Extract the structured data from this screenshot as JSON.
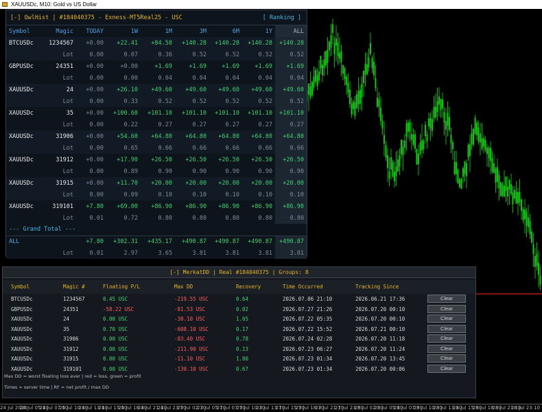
{
  "window": {
    "title": "XAUUSDc, M10:  Gold vs US Dollar",
    "icon": "chart-window-icon"
  },
  "chart_data": {
    "type": "candlestick",
    "symbol": "XAUUSDc",
    "timeframe": "M10",
    "bull_color": "#00e600",
    "bear_color": "#00e600",
    "price_line_color": "#ff2d2d",
    "price_line_level": 0.28,
    "x_tick_labels": [
      "24 Jul 2026",
      "24 Jul 05:10",
      "24 Jul 07:50",
      "24 Jul 10:30",
      "24 Jul 13:10",
      "24 Jul 15:50",
      "24 Jul 18:30",
      "24 Jul 21:10",
      "24 Jul 23:50",
      "27 Jul 02:30",
      "27 Jul 05:10",
      "27 Jul 07:50",
      "27 Jul 10:30",
      "27 Jul 13:10",
      "27 Jul 15:50",
      "27 Jul 18:30",
      "27 Jul 21:10",
      "27 Jul 23:50",
      "28 Jul 02:30",
      "28 Jul 05:10",
      "28 Jul 07:50",
      "28 Jul 10:30",
      "28 Jul 13:10",
      "28 Jul 15:50",
      "28 Jul 18:30",
      "28 Jul 21:10",
      "28 Jul 23:10"
    ]
  },
  "owlhist": {
    "title": "[-] OwlHist | #184040375 - Exness-MT5Real25 - USC",
    "ranking_label": "[ Ranking ]",
    "columns": [
      "Symbol",
      "Magic",
      "TODAY",
      "1W",
      "1M",
      "3M",
      "6M",
      "1Y",
      "ALL"
    ],
    "lot_label": "Lot",
    "rows": [
      {
        "symbol": "BTCUSDc",
        "magic": "1234567",
        "pnl": [
          "+0.00",
          "+22.41",
          "+84.58",
          "+140.28",
          "+140.28",
          "+140.28",
          "+140.28"
        ],
        "lot": [
          "0.00",
          "0.07",
          "0.36",
          "0.52",
          "0.52",
          "0.52",
          "0.52"
        ]
      },
      {
        "symbol": "GBPUSDc",
        "magic": "24351",
        "pnl": [
          "+0.00",
          "+0.00",
          "+1.69",
          "+1.69",
          "+1.69",
          "+1.69",
          "+1.69"
        ],
        "lot": [
          "0.00",
          "0.00",
          "0.04",
          "0.04",
          "0.04",
          "0.04",
          "0.04"
        ]
      },
      {
        "symbol": "XAUUSDc",
        "magic": "24",
        "pnl": [
          "+0.00",
          "+26.10",
          "+49.60",
          "+49.60",
          "+49.60",
          "+49.60",
          "+49.60"
        ],
        "lot": [
          "0.00",
          "0.33",
          "0.52",
          "0.52",
          "0.52",
          "0.52",
          "0.52"
        ]
      },
      {
        "symbol": "XAUUSDc",
        "magic": "35",
        "pnl": [
          "+0.00",
          "+100.60",
          "+101.10",
          "+101.10",
          "+101.10",
          "+101.10",
          "+101.10"
        ],
        "lot": [
          "0.00",
          "0.22",
          "0.27",
          "0.27",
          "0.27",
          "0.27",
          "0.27"
        ]
      },
      {
        "symbol": "XAUUSDc",
        "magic": "31906",
        "pnl": [
          "+0.00",
          "+54.60",
          "+64.80",
          "+64.80",
          "+64.80",
          "+64.80",
          "+64.80"
        ],
        "lot": [
          "0.00",
          "0.65",
          "0.66",
          "0.66",
          "0.66",
          "0.66",
          "0.66"
        ]
      },
      {
        "symbol": "XAUUSDc",
        "magic": "31912",
        "pnl": [
          "+0.00",
          "+17.90",
          "+26.50",
          "+26.50",
          "+26.50",
          "+26.50",
          "+26.50"
        ],
        "lot": [
          "0.00",
          "0.89",
          "0.90",
          "0.90",
          "0.90",
          "0.90",
          "0.90"
        ]
      },
      {
        "symbol": "XAUUSDc",
        "magic": "31915",
        "pnl": [
          "+0.00",
          "+11.70",
          "+20.00",
          "+20.00",
          "+20.00",
          "+20.00",
          "+20.00"
        ],
        "lot": [
          "0.00",
          "0.09",
          "0.10",
          "0.10",
          "0.10",
          "0.10",
          "0.10"
        ]
      },
      {
        "symbol": "XAUUSDc",
        "magic": "319101",
        "pnl": [
          "+7.80",
          "+69.00",
          "+86.90",
          "+86.90",
          "+86.90",
          "+86.90",
          "+86.90"
        ],
        "lot": [
          "0.01",
          "0.72",
          "0.80",
          "0.80",
          "0.80",
          "0.80",
          "0.80"
        ]
      }
    ],
    "grand_total_label": "--- Grand Total ---",
    "total": {
      "symbol": "ALL",
      "magic": "",
      "pnl": [
        "+7.80",
        "+302.31",
        "+435.17",
        "+490.87",
        "+490.87",
        "+490.87",
        "+490.87"
      ],
      "lot": [
        "0.01",
        "2.97",
        "3.65",
        "3.81",
        "3.81",
        "3.81",
        "3.81"
      ]
    },
    "colors": {
      "title": "#e6b422",
      "header": "#4ea0e0",
      "positive": "#3fd26e"
    }
  },
  "merkatdd": {
    "title": "[-] MerkatDD | Real #184040375 | Groups: 8",
    "columns": [
      "Symbol",
      "Magic #",
      "Floating P/L",
      "Max DD",
      "Recovery",
      "Time Occurred",
      "Tracking Since"
    ],
    "clear_label": "Clear",
    "rows": [
      {
        "symbol": "BTCUSDc",
        "magic": "1234567",
        "floating": "0.45 USC",
        "floating_sign": "pos",
        "maxdd": "-219.55 USC",
        "recovery": "0.64",
        "time": "2026.07.06 21:10",
        "since": "2026.06.21 17:36"
      },
      {
        "symbol": "GBPUSDc",
        "magic": "24351",
        "floating": "-58.22 USC",
        "floating_sign": "neg",
        "maxdd": "-81.53 USC",
        "recovery": "0.02",
        "time": "2026.07.27 21:26",
        "since": "2026.07.20 00:10"
      },
      {
        "symbol": "XAUUSDc",
        "magic": "24",
        "floating": "0.00 USC",
        "floating_sign": "pos",
        "maxdd": "-30.10 USC",
        "recovery": "1.65",
        "time": "2026.07.22 05:35",
        "since": "2026.07.20 00:10"
      },
      {
        "symbol": "XAUUSDc",
        "magic": "35",
        "floating": "0.70 USC",
        "floating_sign": "pos",
        "maxdd": "-608.10 USC",
        "recovery": "0.17",
        "time": "2026.07.22 15:52",
        "since": "2026.07.21 00:10"
      },
      {
        "symbol": "XAUUSDc",
        "magic": "31906",
        "floating": "0.00 USC",
        "floating_sign": "pos",
        "maxdd": "-83.40 USC",
        "recovery": "0.78",
        "time": "2026.07.24 02:28",
        "since": "2026.07.20 11:18"
      },
      {
        "symbol": "XAUUSDc",
        "magic": "31912",
        "floating": "0.00 USC",
        "floating_sign": "pos",
        "maxdd": "-211.90 USC",
        "recovery": "0.13",
        "time": "2026.07.23 06:27",
        "since": "2026.07.20 11:24"
      },
      {
        "symbol": "XAUUSDc",
        "magic": "31915",
        "floating": "0.00 USC",
        "floating_sign": "pos",
        "maxdd": "-11.10 USC",
        "recovery": "1.80",
        "time": "2026.07.23 01:34",
        "since": "2026.07.20 13:45"
      },
      {
        "symbol": "XAUUSDc",
        "magic": "319101",
        "floating": "0.00 USC",
        "floating_sign": "pos",
        "maxdd": "-130.10 USC",
        "recovery": "0.67",
        "time": "2026.07.23 01:34",
        "since": "2026.07.20 00:06"
      }
    ],
    "note1": "Max DD = worst floating loss ever | red = loss, green = profit",
    "note2": "Times = server time | RF = net profit / max DD",
    "colors": {
      "title": "#e6b422",
      "negative": "#ff5a5a",
      "positive": "#3fd26e"
    }
  }
}
